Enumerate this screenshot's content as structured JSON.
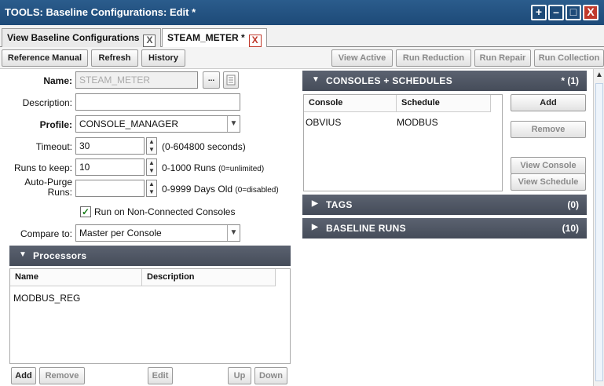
{
  "window": {
    "title": "TOOLS: Baseline Configurations: Edit *",
    "buttons": [
      "+",
      "–",
      "□",
      "X"
    ]
  },
  "tabs": [
    {
      "label": "View Baseline Configurations",
      "close": "X"
    },
    {
      "label": "STEAM_METER *",
      "close": "X"
    }
  ],
  "toolbar": {
    "left": [
      "Reference Manual",
      "Refresh",
      "History"
    ],
    "right": [
      "View Active",
      "Run Reduction",
      "Run Repair",
      "Run Collection"
    ]
  },
  "form": {
    "name_label": "Name:",
    "name_value": "STEAM_METER",
    "name_btn": "...",
    "desc_label": "Description:",
    "desc_value": "",
    "profile_label": "Profile:",
    "profile_value": "CONSOLE_MANAGER",
    "timeout_label": "Timeout:",
    "timeout_value": "30",
    "timeout_hint": "(0-604800 seconds)",
    "runs_label": "Runs to keep:",
    "runs_value": "10",
    "runs_hint": "0-1000 Runs",
    "runs_hint_small": "(0=unlimited)",
    "purge_label": "Auto-Purge Runs:",
    "purge_value": "",
    "purge_hint": "0-9999 Days Old",
    "purge_hint_small": "(0=disabled)",
    "nonconn_label": "Run on Non-Connected Consoles",
    "nonconn_checked": true,
    "compare_label": "Compare to:",
    "compare_value": "Master per Console"
  },
  "processors": {
    "title": "Processors",
    "columns": [
      "Name",
      "Description"
    ],
    "rows": [
      {
        "name": "MODBUS_REG",
        "description": ""
      }
    ],
    "buttons": [
      "Add",
      "Remove",
      "Edit",
      "Up",
      "Down"
    ]
  },
  "consoles": {
    "title": "CONSOLES + SCHEDULES",
    "count": "* (1)",
    "columns": [
      "Console",
      "Schedule"
    ],
    "rows": [
      {
        "console": "OBVIUS",
        "schedule": "MODBUS"
      }
    ],
    "buttons": [
      "Add",
      "Remove",
      "View Console",
      "View Schedule"
    ]
  },
  "tags": {
    "title": "TAGS",
    "count": "(0)"
  },
  "baseline_runs": {
    "title": "BASELINE RUNS",
    "count": "(10)"
  }
}
